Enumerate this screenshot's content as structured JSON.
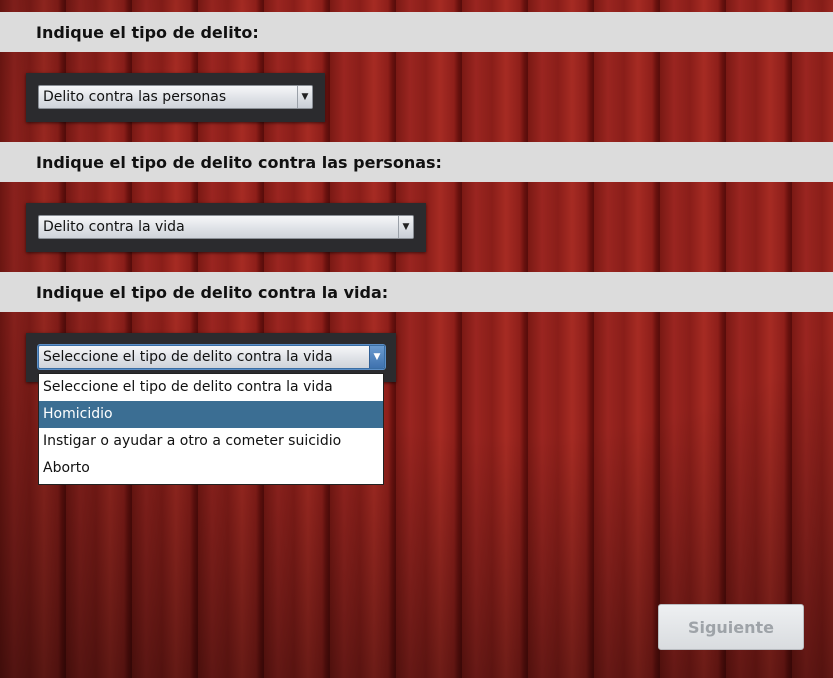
{
  "questions": [
    {
      "label": "Indique el tipo de delito:",
      "selected": "Delito contra las personas"
    },
    {
      "label": "Indique el tipo de delito contra las personas:",
      "selected": "Delito contra la vida"
    },
    {
      "label": "Indique el tipo de delito contra la vida:",
      "selected": "Seleccione el tipo de delito contra la vida",
      "options": [
        "Seleccione el tipo de delito contra la vida",
        "Homicidio",
        "Instigar o ayudar a otro a cometer suicidio",
        "Aborto"
      ],
      "highlighted_option": "Homicidio",
      "dropdown_open": true
    }
  ],
  "next_button_label": "Siguiente",
  "next_button_enabled": false,
  "dropdown_arrow_icon": "chevron-down-icon",
  "colors": {
    "header_bar": "#dcdcdc",
    "panel": "#2b2b2e",
    "highlight": "#3b6e93",
    "background_wood": "#8a1e19"
  }
}
